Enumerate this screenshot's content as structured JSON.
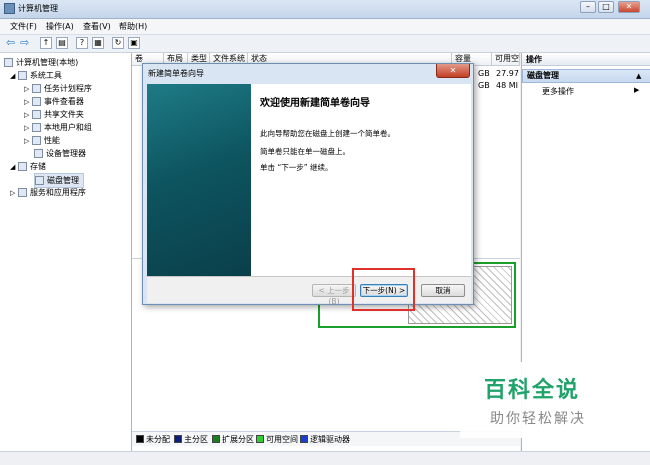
{
  "window": {
    "title": "计算机管理"
  },
  "menubar": [
    {
      "label": "文件(F)"
    },
    {
      "label": "操作(A)"
    },
    {
      "label": "查看(V)"
    },
    {
      "label": "帮助(H)"
    }
  ],
  "tree": {
    "items": [
      {
        "label": "计算机管理(本地)",
        "icon": "computer-icon"
      },
      {
        "label": "系统工具",
        "icon": "tools-icon"
      },
      {
        "label": "任务计划程序",
        "icon": "clock-icon"
      },
      {
        "label": "事件查看器",
        "icon": "event-icon"
      },
      {
        "label": "共享文件夹",
        "icon": "folder-icon"
      },
      {
        "label": "本地用户和组",
        "icon": "users-icon"
      },
      {
        "label": "性能",
        "icon": "performance-icon"
      },
      {
        "label": "设备管理器",
        "icon": "device-icon"
      },
      {
        "label": "存储",
        "icon": "storage-icon"
      },
      {
        "label": "磁盘管理",
        "icon": "disk-icon"
      },
      {
        "label": "服务和应用程序",
        "icon": "services-icon"
      }
    ]
  },
  "center": {
    "columns": [
      "卷",
      "布局",
      "类型",
      "文件系统",
      "状态",
      "容量",
      "可用空"
    ],
    "rows": [
      {
        "capacity": "GB",
        "free": "27.97"
      },
      {
        "capacity": "GB",
        "free": "48 MI"
      }
    ]
  },
  "legend": [
    {
      "label": "未分配",
      "color": "#000000"
    },
    {
      "label": "主分区",
      "color": "#0a1f7a"
    },
    {
      "label": "扩展分区",
      "color": "#1d7d1d"
    },
    {
      "label": "可用空间",
      "color": "#33cc33"
    },
    {
      "label": "逻辑驱动器",
      "color": "#1a3fd0"
    }
  ],
  "actions": {
    "header": "操作",
    "selected": "磁盘管理",
    "more": "更多操作"
  },
  "dialog": {
    "title": "新建简单卷向导",
    "heading": "欢迎使用新建简单卷向导",
    "line1": "此向导帮助您在磁盘上创建一个简单卷。",
    "line2": "简单卷只能在单一磁盘上。",
    "line3": "单击 “下一步” 继续。",
    "back_label": "< 上一步(B)",
    "next_label": "下一步(N) >",
    "cancel_label": "取消"
  },
  "watermark": {
    "big": "百科全说",
    "small": "助你轻松解决"
  }
}
